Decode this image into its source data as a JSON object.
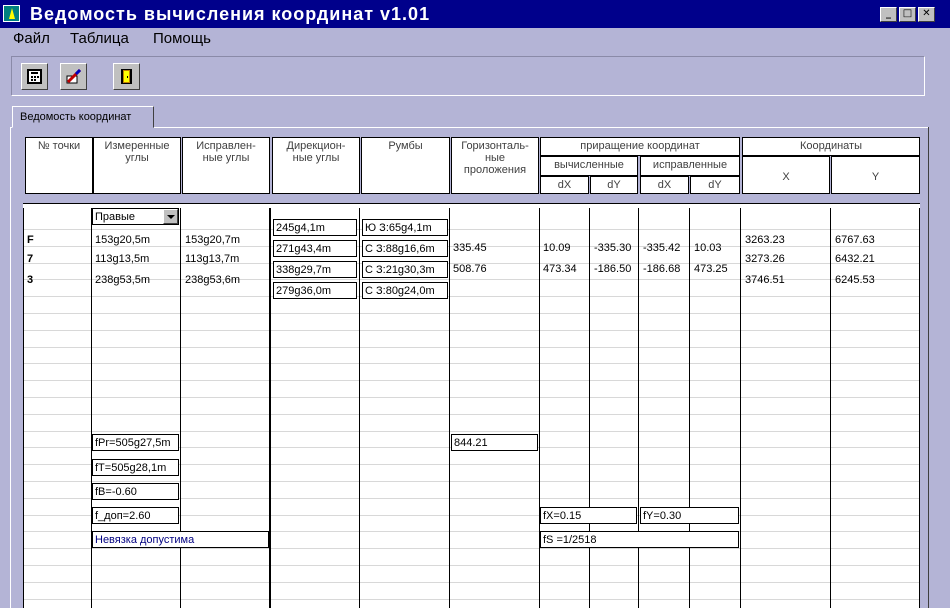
{
  "window": {
    "title": "Ведомость вычисления координат v1.01"
  },
  "menu": {
    "file": "Файл",
    "table": "Таблица",
    "help": "Помощь"
  },
  "tab": {
    "label": "Ведомость координат"
  },
  "headers": {
    "point_no": "№ точки",
    "measured": "Измеренные углы",
    "corrected": "Исправлен-ные углы",
    "direction": "Дирекцион-ные углы",
    "bearings": "Румбы",
    "horizontal": "Горизонталь-ные проложения",
    "increments": "приращение координат",
    "computed": "вычисленные",
    "adjusted": "исправленные",
    "dx1": "dX",
    "dy1": "dY",
    "dx2": "dX",
    "dy2": "dY",
    "coords": "Координаты",
    "x": "X",
    "y": "Y"
  },
  "angle_type": {
    "selected": "Правые"
  },
  "rows": [
    {
      "point": "F",
      "measured": "153g20,5m",
      "corrected": "153g20,7m",
      "horizontal": "335.45",
      "dx_c": "10.09",
      "dy_c": "-335.30",
      "dx_a": "-335.42",
      "dy_a": "10.03",
      "x": "3263.23",
      "y": "6767.63"
    },
    {
      "point": "7",
      "measured": "113g13,5m",
      "corrected": "113g13,7m",
      "horizontal": "508.76",
      "dx_c": "473.34",
      "dy_c": "-186.50",
      "dx_a": "-186.68",
      "dy_a": "473.25",
      "x": "3273.26",
      "y": "6432.21"
    },
    {
      "point": "3",
      "measured": "238g53,5m",
      "corrected": "238g53,6m",
      "horizontal": "",
      "dx_c": "",
      "dy_c": "",
      "dx_a": "",
      "dy_a": "",
      "x": "3746.51",
      "y": "6245.53"
    }
  ],
  "direction_angles": [
    "245g4,1m",
    "271g43,4m",
    "338g29,7m",
    "279g36,0m"
  ],
  "bearings": [
    "Ю З:65g4,1m",
    "С З:88g16,6m",
    "С З:21g30,3m",
    "С З:80g24,0m"
  ],
  "summary": {
    "fpr": "fPr=505g27,5m",
    "ft": "fT=505g28,1m",
    "fb": "fB=-0.60",
    "f_allowed": "f_доп=2.60",
    "verdict": "Невязка допустима",
    "perimeter": "844.21",
    "fx": "fX=0.15",
    "fy": "fY=0.30",
    "fs": "fS =1/2518"
  },
  "colors": {
    "title_bg": "#00008b",
    "window_bg": "#b4b4d6",
    "verdict_text": "#000080"
  }
}
